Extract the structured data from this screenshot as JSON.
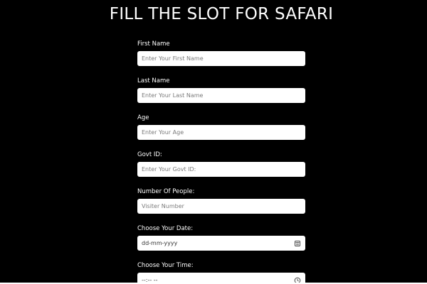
{
  "form": {
    "title": "FILL THE SLOT FOR SAFARI",
    "fields": [
      {
        "label": "First Name",
        "placeholder": "Enter Your First Name"
      },
      {
        "label": "Last Name",
        "placeholder": "Enter Your Last Name"
      },
      {
        "label": "Age",
        "placeholder": "Enter Your Age"
      },
      {
        "label": "Govt ID:",
        "placeholder": "Enter Your Govt ID:"
      },
      {
        "label": "Number Of People:",
        "placeholder": "Visiter Number"
      },
      {
        "label": "Choose Your Date:",
        "value": "dd-mm-yyyy",
        "icon": "calendar-icon"
      },
      {
        "label": "Choose Your Time:",
        "value": "--:-- --",
        "icon": "clock-icon"
      }
    ]
  },
  "colors": {
    "background": "#000000",
    "text": "#ffffff",
    "input_background": "#ffffff",
    "placeholder": "#7a7a7a"
  }
}
